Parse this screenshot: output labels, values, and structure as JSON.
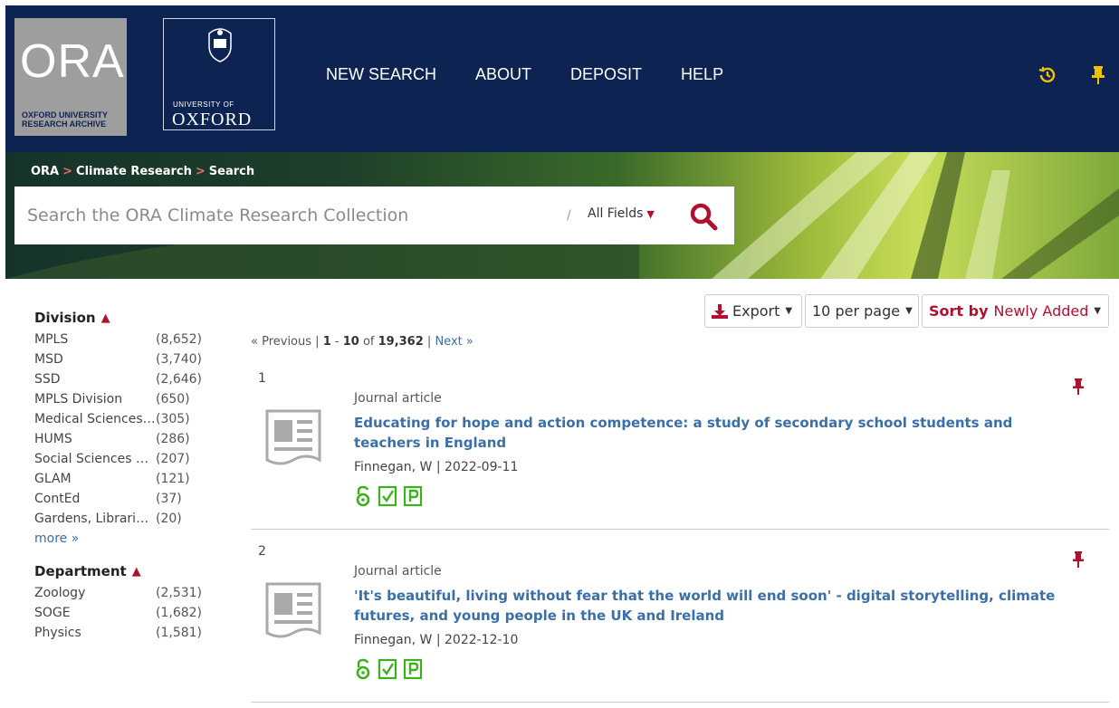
{
  "header": {
    "ora_logo_big": "ORA",
    "ora_logo_small_line1": "OXFORD UNIVERSITY",
    "ora_logo_small_line2": "RESEARCH ARCHIVE",
    "oxford_line1": "UNIVERSITY OF",
    "oxford_line2": "OXFORD",
    "nav": [
      "NEW SEARCH",
      "ABOUT",
      "DEPOSIT",
      "HELP"
    ],
    "icons": [
      "history-icon",
      "pin-icon"
    ],
    "icon_color": "#f2c200"
  },
  "breadcrumb": {
    "items": [
      "ORA",
      "Climate Research",
      "Search"
    ],
    "separator": ">"
  },
  "search": {
    "placeholder": "Search the ORA Climate Research Collection",
    "value": "",
    "slash": "/",
    "field_selector": "All Fields"
  },
  "toolbar": {
    "export_label": "Export",
    "per_page_label": "10 per page",
    "sort_prefix": "Sort by",
    "sort_value": "Newly Added"
  },
  "pagination": {
    "prev": "« Previous",
    "sep": "|",
    "range_start": "1",
    "range_dash": " - ",
    "range_end": "10",
    "of": " of ",
    "total": "19,362",
    "next": "Next »"
  },
  "facets": [
    {
      "title": "Division",
      "items": [
        {
          "label": "MPLS",
          "count": "(8,652)"
        },
        {
          "label": "MSD",
          "count": "(3,740)"
        },
        {
          "label": "SSD",
          "count": "(2,646)"
        },
        {
          "label": "MPLS Division",
          "count": "(650)"
        },
        {
          "label": "Medical Sciences Division",
          "count": "(305)"
        },
        {
          "label": "HUMS",
          "count": "(286)"
        },
        {
          "label": "Social Sciences Division",
          "count": "(207)"
        },
        {
          "label": "GLAM",
          "count": "(121)"
        },
        {
          "label": "ContEd",
          "count": "(37)"
        },
        {
          "label": "Gardens, Libraries and Museums",
          "count": "(20)"
        }
      ],
      "more": "more »"
    },
    {
      "title": "Department",
      "items": [
        {
          "label": "Zoology",
          "count": "(2,531)"
        },
        {
          "label": "SOGE",
          "count": "(1,682)"
        },
        {
          "label": "Physics",
          "count": "(1,581)"
        }
      ]
    }
  ],
  "results": [
    {
      "num": "1",
      "type": "Journal article",
      "title": "Educating for hope and action competence: a study of secondary school students and teachers in England",
      "author": "Finnegan, W",
      "meta_sep": " | ",
      "date": "2022-09-11",
      "badges": [
        "open-access-icon",
        "peer-reviewed-icon",
        "published-icon"
      ]
    },
    {
      "num": "2",
      "type": "Journal article",
      "title": "'It's beautiful, living without fear that the world will end soon' - digital storytelling, climate futures, and young people in the UK and Ireland",
      "author": "Finnegan, W",
      "meta_sep": " | ",
      "date": "2022-12-10",
      "badges": [
        "open-access-icon",
        "peer-reviewed-icon",
        "published-icon"
      ]
    }
  ],
  "colors": {
    "header_bg": "#0d2453",
    "accent_red": "#b2102f",
    "link_blue": "#3a6fa8",
    "badge_green": "#3bb21b"
  }
}
